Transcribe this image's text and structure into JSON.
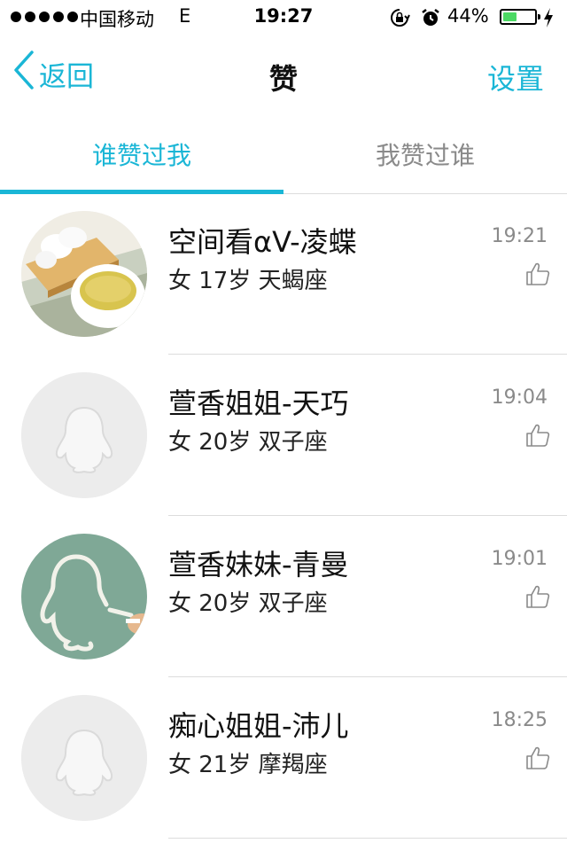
{
  "status_bar": {
    "carrier": "中国移动",
    "network": "E",
    "time": "19:27",
    "battery_percent": "44%",
    "battery_level": 0.44
  },
  "nav": {
    "back_label": "返回",
    "title": "赞",
    "settings_label": "设置"
  },
  "tabs": [
    {
      "label": "谁赞过我",
      "active": true
    },
    {
      "label": "我赞过谁",
      "active": false
    }
  ],
  "list": [
    {
      "name": "空间看αV-凌蝶",
      "meta": "女 17岁 天蝎座",
      "time": "19:21",
      "avatar": "tea-photo"
    },
    {
      "name": "萱香姐姐-天巧",
      "meta": "女 20岁 双子座",
      "time": "19:04",
      "avatar": "default-penguin"
    },
    {
      "name": "萱香妹妹-青曼",
      "meta": "女 20岁 双子座",
      "time": "19:01",
      "avatar": "chalkboard-penguin"
    },
    {
      "name": "痴心姐姐-沛儿",
      "meta": "女 21岁 摩羯座",
      "time": "18:25",
      "avatar": "default-penguin"
    }
  ],
  "colors": {
    "accent": "#1ab6d6",
    "battery_green": "#4cd964",
    "divider": "#dcdcdc",
    "secondary_text": "#8a8a8a"
  },
  "icons": {
    "back": "chevron-left-icon",
    "like": "thumbs-up-icon",
    "lock": "rotation-lock-icon",
    "alarm": "alarm-clock-icon",
    "charging": "bolt-icon"
  }
}
